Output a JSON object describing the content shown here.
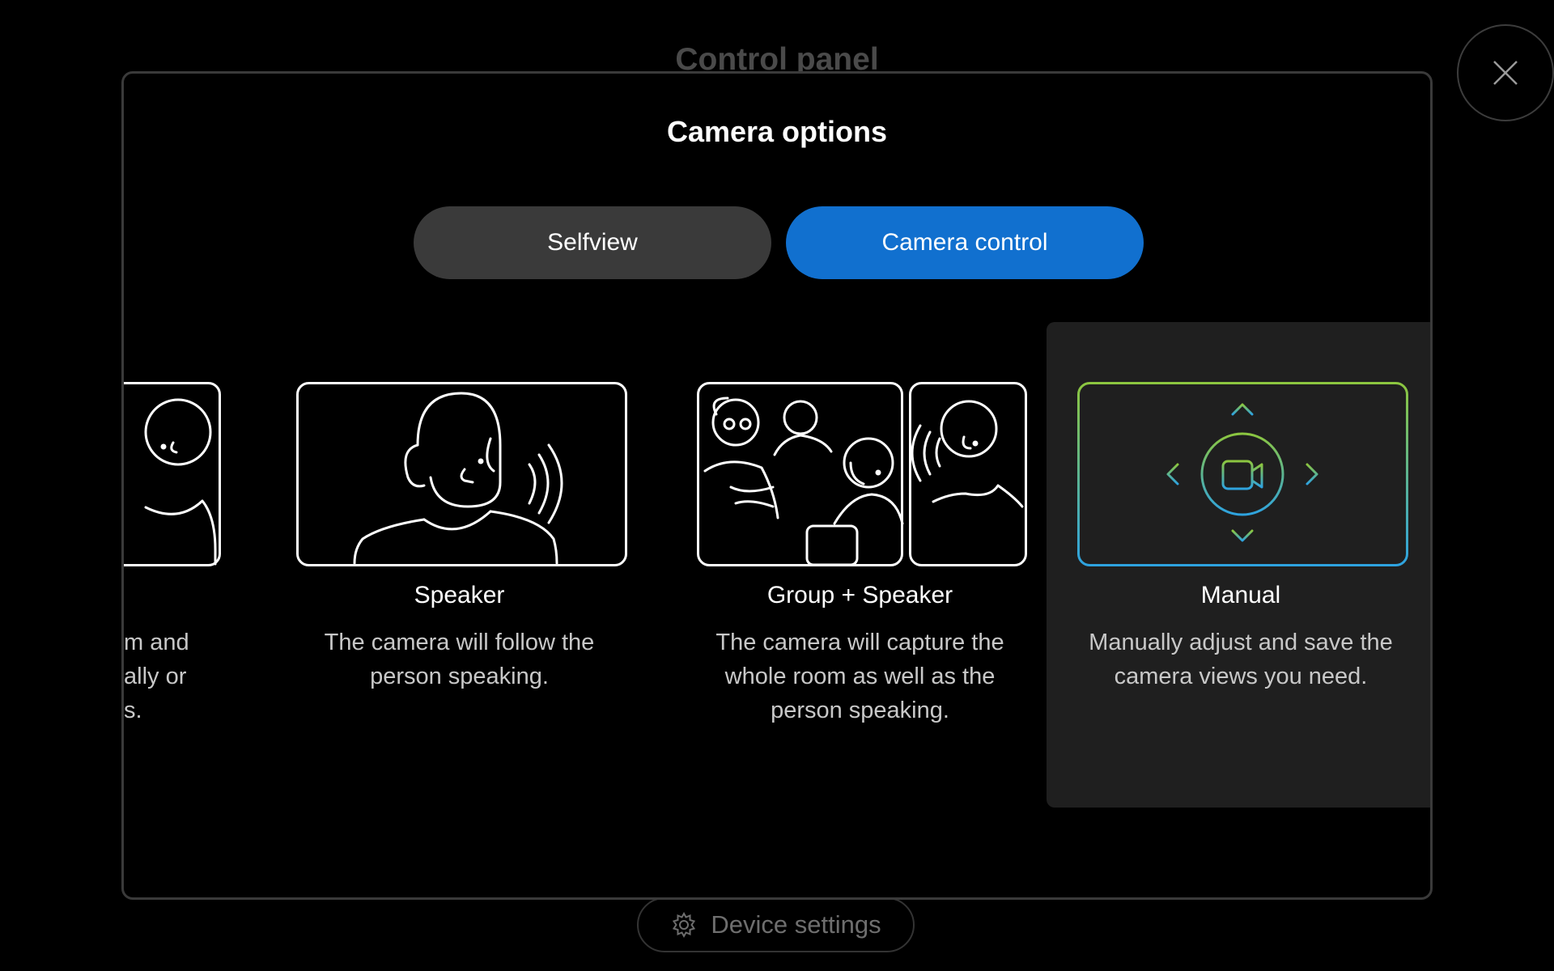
{
  "background": {
    "title": "Control panel",
    "device_settings_label": "Device settings"
  },
  "modal": {
    "title": "Camera options",
    "tabs": [
      {
        "label": "Selfview",
        "active": false
      },
      {
        "label": "Camera control",
        "active": true
      }
    ],
    "cards": [
      {
        "label": "",
        "desc_lines": [
          "m and",
          "ally or",
          "s."
        ],
        "partial": true
      },
      {
        "label": "Speaker",
        "desc_lines": [
          "The camera will follow the",
          "person speaking."
        ]
      },
      {
        "label": "Group + Speaker",
        "desc_lines": [
          "The camera will capture the",
          "whole room as well as the",
          "person speaking."
        ]
      },
      {
        "label": "Manual",
        "desc_lines": [
          "Manually adjust and save the",
          "camera views you need."
        ],
        "selected": true
      }
    ]
  },
  "colors": {
    "accent": "#1170cf",
    "gradient_top": "#8cc63f",
    "gradient_bottom": "#2ea3e0"
  },
  "icons": [
    "close-icon",
    "gear-icon",
    "camera-icon",
    "chevron-up-icon",
    "chevron-down-icon",
    "chevron-left-icon",
    "chevron-right-icon"
  ]
}
